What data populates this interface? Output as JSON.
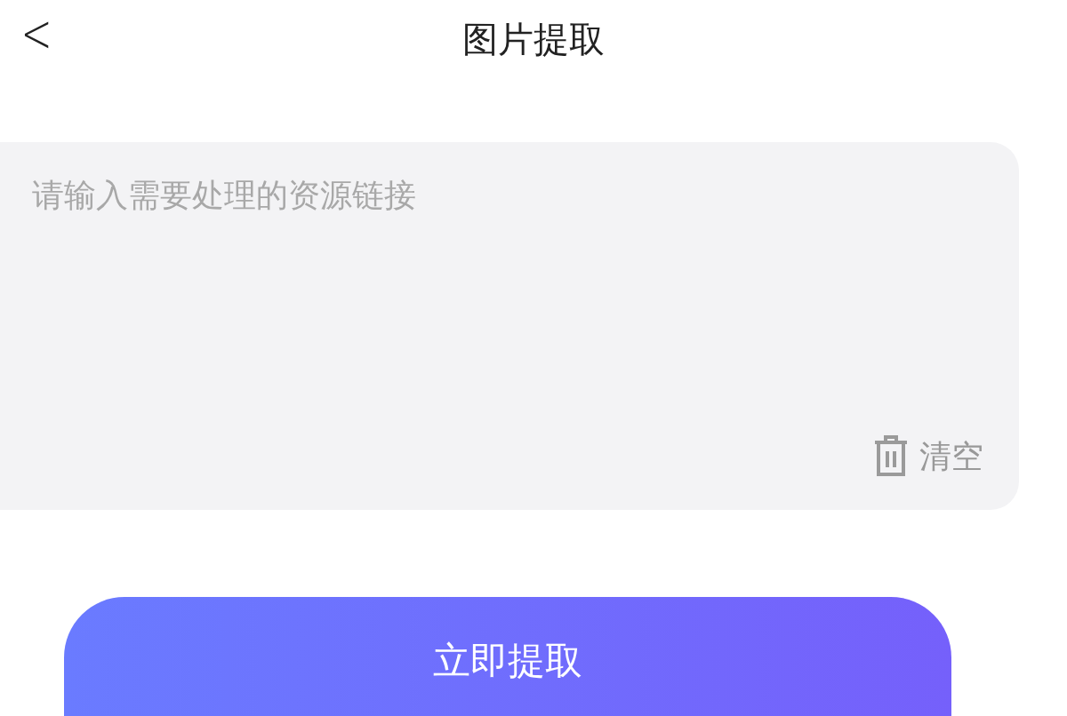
{
  "header": {
    "back": "<",
    "title": "图片提取"
  },
  "link_input": {
    "placeholder": "请输入需要处理的资源链接",
    "clear": "清空"
  },
  "submit_button": "立即提取"
}
